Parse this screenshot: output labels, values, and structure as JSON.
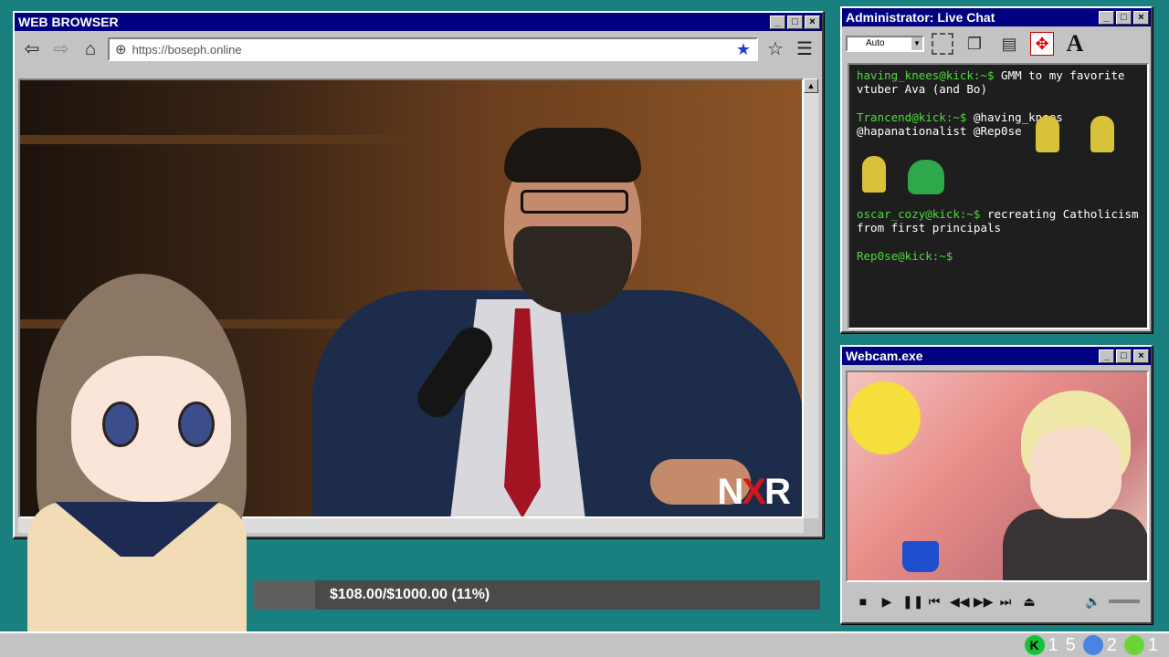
{
  "browser": {
    "title": "WEB BROWSER",
    "url": "https://boseph.online",
    "watermark_n": "N",
    "watermark_x": "X",
    "watermark_r": "R"
  },
  "chat": {
    "title": "Administrator: Live Chat",
    "font_select": "Auto",
    "messages": [
      {
        "user": "having_knees@kick:~$",
        "text": " GMM to my favorite vtuber Ava (and Bo)"
      },
      {
        "user": "Trancend@kick:~$",
        "text": " @having_knees @hapanationalist @Rep0se"
      },
      {
        "user": "oscar_cozy@kick:~$",
        "text": " recreating Catholicism from first principals"
      },
      {
        "user": "Rep0se@kick:~$",
        "text": ""
      }
    ]
  },
  "webcam": {
    "title": "Webcam.exe"
  },
  "donation": {
    "text": "$108.00/$1000.00 (11%)",
    "progress": 0.108
  },
  "taskbar": {
    "count_kick": "1",
    "count_sleep": "5",
    "count_moon": "2",
    "count_play": "1"
  },
  "colors": {
    "desktop": "#1a7f7f",
    "titlebar": "#000080",
    "chat_user": "#4ddc3a"
  }
}
